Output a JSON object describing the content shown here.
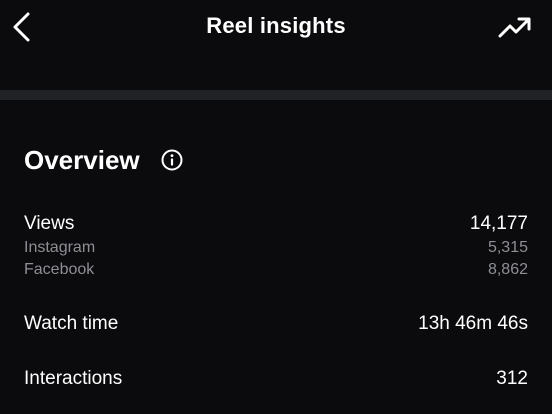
{
  "header": {
    "title": "Reel insights",
    "back_icon": "chevron-left-icon",
    "trend_icon": "trending-up-icon"
  },
  "overview": {
    "title": "Overview",
    "info_icon": "info-icon",
    "views": {
      "label": "Views",
      "value": "14,177",
      "breakdown": [
        {
          "label": "Instagram",
          "value": "5,315"
        },
        {
          "label": "Facebook",
          "value": "8,862"
        }
      ]
    },
    "watch_time": {
      "label": "Watch time",
      "value": "13h 46m 46s"
    },
    "interactions": {
      "label": "Interactions",
      "value": "312"
    }
  },
  "colors": {
    "background": "#0b0b0d",
    "divider": "#202226",
    "primary_text": "#ffffff",
    "secondary_text": "#8d8f95"
  }
}
